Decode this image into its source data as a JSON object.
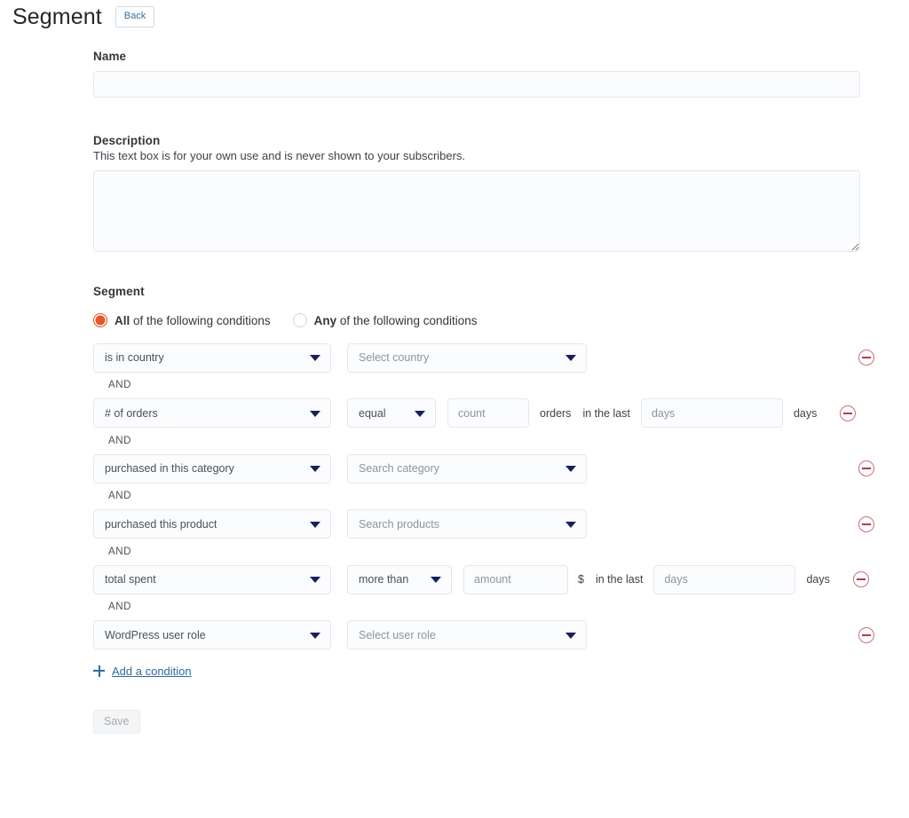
{
  "header": {
    "title": "Segment",
    "back_label": "Back"
  },
  "form": {
    "name": {
      "label": "Name",
      "value": "",
      "placeholder": ""
    },
    "description": {
      "label": "Description",
      "help": "This text box is for your own use and is never shown to your subscribers.",
      "value": "",
      "placeholder": ""
    },
    "segment": {
      "label": "Segment",
      "match_options": [
        {
          "strong": "All",
          "rest": " of the following conditions",
          "selected": true
        },
        {
          "strong": "Any",
          "rest": " of the following conditions",
          "selected": false
        }
      ],
      "and_label": "AND",
      "conditions": [
        {
          "type": "select-only",
          "subject": "is in country",
          "value_placeholder": "Select country"
        },
        {
          "type": "count-range",
          "subject": "# of orders",
          "operator": "equal",
          "count_placeholder": "count",
          "unit_label": "orders",
          "in_the_last_label": "in the last",
          "days_placeholder": "days",
          "days_label": "days"
        },
        {
          "type": "select-only",
          "subject": "purchased in this category",
          "value_placeholder": "Search category"
        },
        {
          "type": "select-only",
          "subject": "purchased this product",
          "value_placeholder": "Search products"
        },
        {
          "type": "amount-range",
          "subject": "total spent",
          "operator": "more than",
          "amount_placeholder": "amount",
          "currency_label": "$",
          "in_the_last_label": "in the last",
          "days_placeholder": "days",
          "days_label": "days"
        },
        {
          "type": "select-only",
          "subject": "WordPress user role",
          "value_placeholder": "Select user role"
        }
      ],
      "add_condition_label": "Add a condition"
    },
    "save_label": "Save"
  },
  "icons": {
    "caret": "chevron-down-icon",
    "remove": "remove-circle-icon",
    "plus": "plus-icon"
  },
  "colors": {
    "accent_radio": "#e8552b",
    "link": "#2e6b9e",
    "caret": "#16215a",
    "remove": "#b23a4a"
  }
}
